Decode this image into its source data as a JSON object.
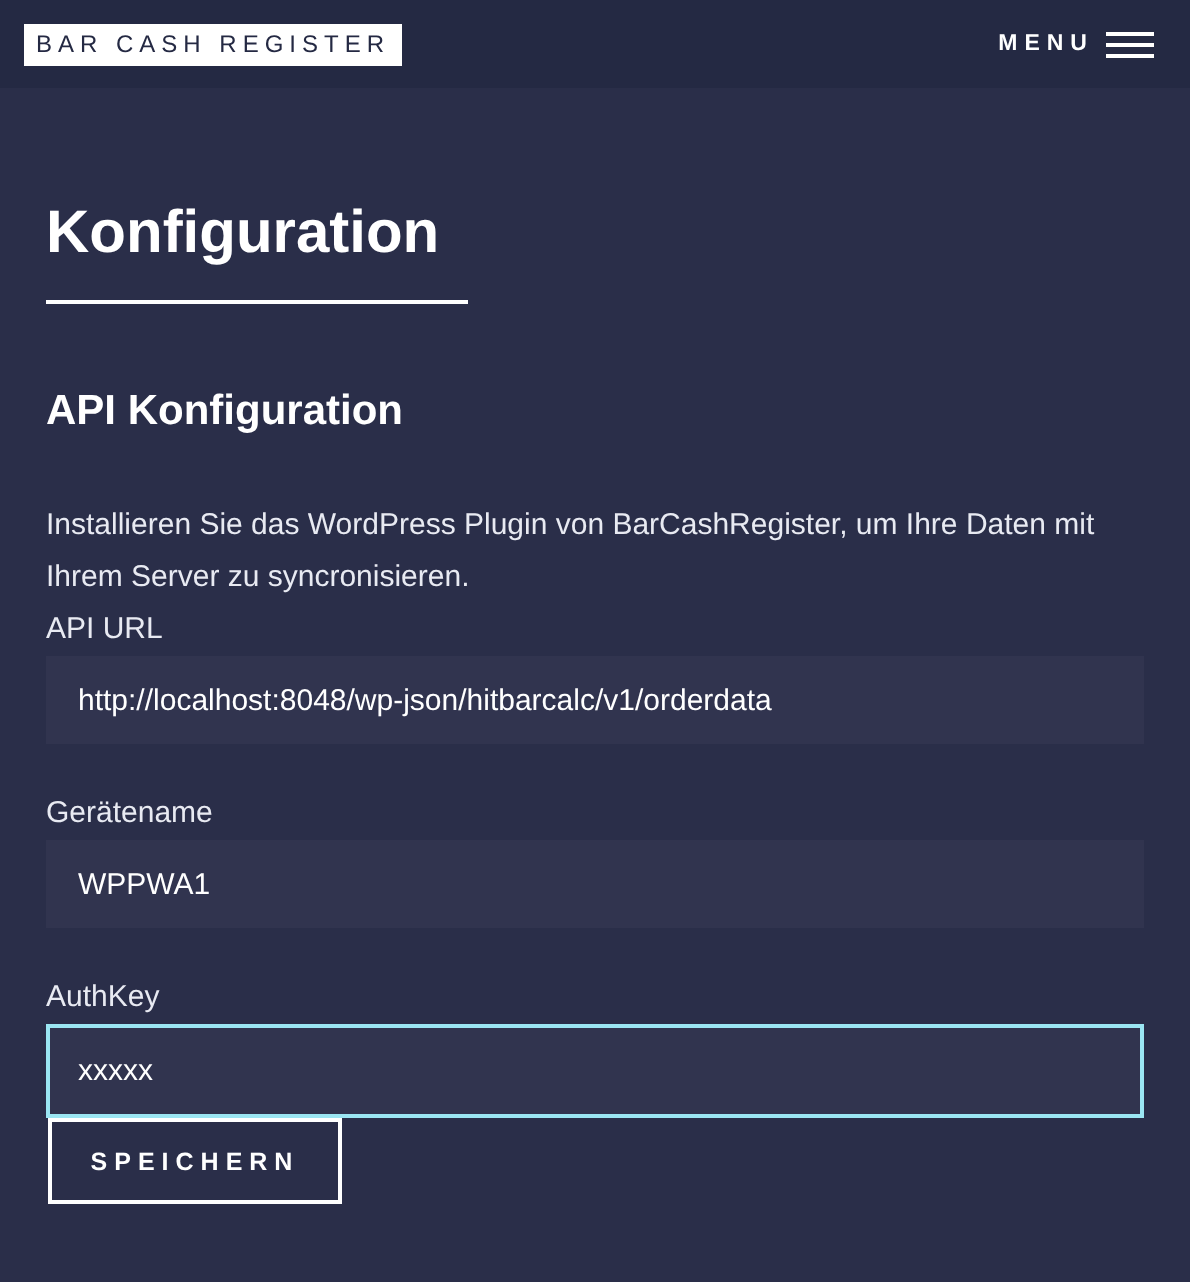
{
  "header": {
    "logo": "BAR CASH REGISTER",
    "menu": "MENU"
  },
  "title": "Konfiguration",
  "section": "API Konfiguration",
  "description": "Installieren Sie das WordPress Plugin von BarCashRegister, um Ihre Daten mit Ihrem Server zu syncronisieren.",
  "fields": [
    {
      "label": "API URL",
      "value": "http://localhost:8048/wp-json/hitbarcalc/v1/orderdata",
      "focused": false
    },
    {
      "label": "Gerätename",
      "value": "WPPWA1",
      "focused": false
    },
    {
      "label": "AuthKey",
      "value": "xxxxx",
      "focused": true
    }
  ],
  "button": "SPEICHERN"
}
